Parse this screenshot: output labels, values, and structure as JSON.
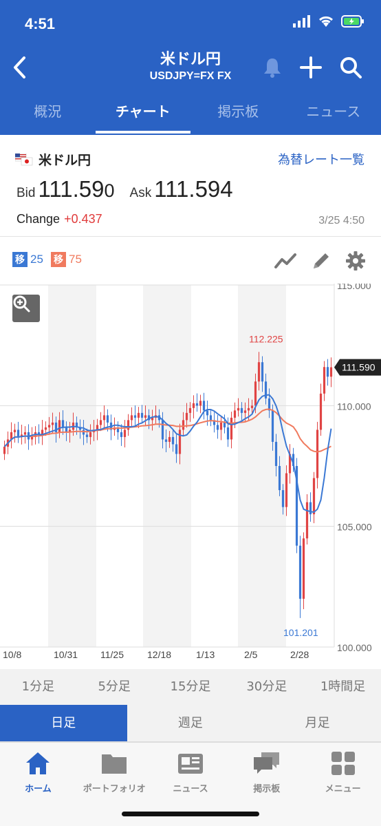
{
  "status": {
    "time": "4:51"
  },
  "nav": {
    "title": "米ドル円",
    "subtitle": "USDJPY=FX FX"
  },
  "tabs": [
    {
      "label": "概況",
      "active": false
    },
    {
      "label": "チャート",
      "active": true
    },
    {
      "label": "掲示板",
      "active": false
    },
    {
      "label": "ニュース",
      "active": false
    }
  ],
  "quote": {
    "pair_name": "米ドル円",
    "rates_link": "為替レート一覧",
    "bid_label": "Bid",
    "bid_main": "111.59",
    "bid_last": "0",
    "ask_label": "Ask",
    "ask_value": "111.594",
    "change_label": "Change",
    "change_value": "+0.437",
    "timestamp": "3/25 4:50"
  },
  "moving_averages": [
    {
      "label": "移",
      "period": "25",
      "color": "#3a78d4"
    },
    {
      "label": "移",
      "period": "75",
      "color": "#f07a5e"
    }
  ],
  "chart_data": {
    "type": "candlestick",
    "x_tick_labels": [
      "10/8",
      "10/31",
      "11/25",
      "12/18",
      "1/13",
      "2/5",
      "2/28"
    ],
    "y_tick_labels": [
      "115.000",
      "110.000",
      "105.000",
      "100.000"
    ],
    "ylim": [
      100,
      115
    ],
    "current_price_label": "111.590",
    "high_annotation": "112.225",
    "low_annotation": "101.201",
    "close_series": [
      108.3,
      108.6,
      108.9,
      109.0,
      108.7,
      108.8,
      108.9,
      108.6,
      108.7,
      108.9,
      108.8,
      109.0,
      109.1,
      109.2,
      109.3,
      108.9,
      109.4,
      109.1,
      108.9,
      109.0,
      109.3,
      109.1,
      109.0,
      108.8,
      108.7,
      108.9,
      109.0,
      109.2,
      109.4,
      109.6,
      109.3,
      109.0,
      109.1,
      108.9,
      108.7,
      109.0,
      109.4,
      109.6,
      109.5,
      109.7,
      109.5,
      109.6,
      109.4,
      109.5,
      109.6,
      109.4,
      108.6,
      108.5,
      108.7,
      108.4,
      108.0,
      109.0,
      109.4,
      109.7,
      109.9,
      110.1,
      110.0,
      110.2,
      109.8,
      109.6,
      109.4,
      109.2,
      109.0,
      109.3,
      109.1,
      108.6,
      109.5,
      109.8,
      109.9,
      109.7,
      109.8,
      109.9,
      110.0,
      111.0,
      111.8,
      111.0,
      110.3,
      109.8,
      108.5,
      107.5,
      106.5,
      105.8,
      107.2,
      108.0,
      107.5,
      104.2,
      102.0,
      104.5,
      106.0,
      105.5,
      107.0,
      109.0,
      110.5,
      111.6,
      111.2,
      111.59
    ]
  },
  "periods_row1": [
    "1分足",
    "5分足",
    "15分足",
    "30分足",
    "1時間足"
  ],
  "periods_row2": [
    {
      "label": "日足",
      "active": true
    },
    {
      "label": "週足",
      "active": false
    },
    {
      "label": "月足",
      "active": false
    }
  ],
  "bottom_nav": [
    {
      "label": "ホーム",
      "icon": "home-icon",
      "active": true
    },
    {
      "label": "ポートフォリオ",
      "icon": "folder-icon",
      "active": false
    },
    {
      "label": "ニュース",
      "icon": "news-icon",
      "active": false
    },
    {
      "label": "掲示板",
      "icon": "chat-icon",
      "active": false
    },
    {
      "label": "メニュー",
      "icon": "menu-grid-icon",
      "active": false
    }
  ]
}
